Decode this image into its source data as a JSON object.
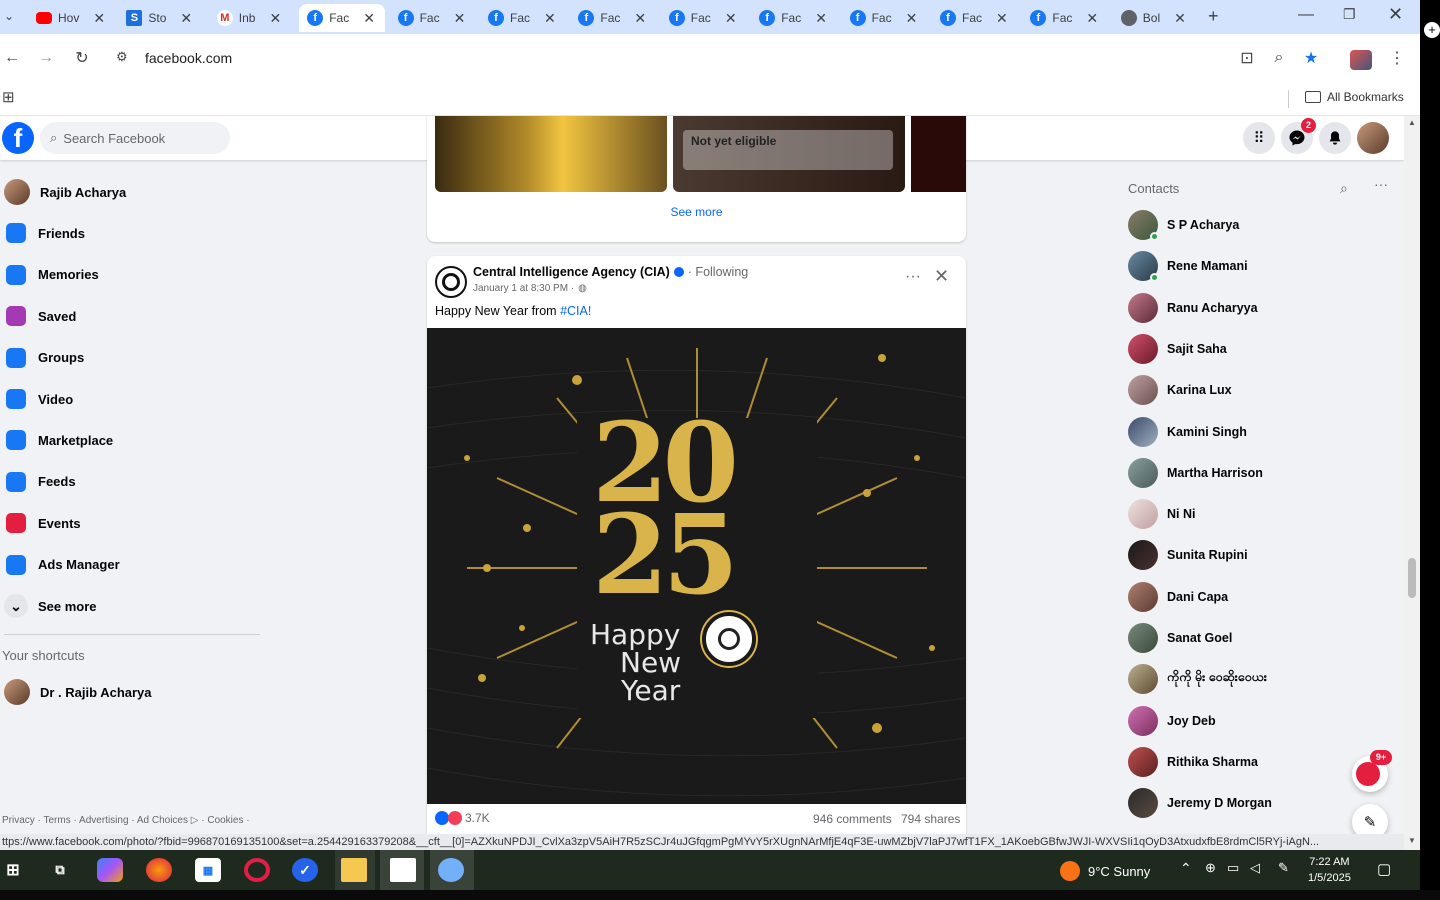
{
  "browser": {
    "tabs": [
      {
        "label": "Hov",
        "icon": "youtube-icon"
      },
      {
        "label": "Sto",
        "icon": "s-icon"
      },
      {
        "label": "Inb",
        "icon": "gmail-icon"
      },
      {
        "label": "Fac",
        "icon": "facebook-icon",
        "active": true
      },
      {
        "label": "Fac",
        "icon": "facebook-icon"
      },
      {
        "label": "Fac",
        "icon": "facebook-icon"
      },
      {
        "label": "Fac",
        "icon": "facebook-icon"
      },
      {
        "label": "Fac",
        "icon": "facebook-icon"
      },
      {
        "label": "Fac",
        "icon": "facebook-icon"
      },
      {
        "label": "Fac",
        "icon": "facebook-icon"
      },
      {
        "label": "Fac",
        "icon": "facebook-icon"
      },
      {
        "label": "Fac",
        "icon": "facebook-icon"
      },
      {
        "label": "Bol",
        "icon": "globe-icon"
      }
    ],
    "url": "facebook.com",
    "all_bookmarks": "All Bookmarks",
    "status_url": "ttps://www.facebook.com/photo/?fbid=996870169135100&set=a.254429163379208&__cft__[0]=AZXkuNPDJI_CvlXa3zpV5AiH7R5zSCJr4uJGfqgmPgMYvY5rXUgnNArMfjE4qF3E-uwMZbjV7laPJ7wfT1FX_1AKoebGBfwJWJI-WXVSIi1qOyD3AtxudxfbE8rdmCl5RYj-iAgN..."
  },
  "facebook": {
    "search_placeholder": "Search Facebook",
    "messenger_badge": "2",
    "sidebar": [
      {
        "label": "Rajib Acharya",
        "icon": "profile-avatar",
        "color": "#8b5a3c"
      },
      {
        "label": "Friends",
        "icon": "friends-icon",
        "color": "#1877f2"
      },
      {
        "label": "Memories",
        "icon": "memories-icon",
        "color": "#1877f2"
      },
      {
        "label": "Saved",
        "icon": "saved-icon",
        "color": "#a33ab2"
      },
      {
        "label": "Groups",
        "icon": "groups-icon",
        "color": "#1877f2"
      },
      {
        "label": "Video",
        "icon": "video-icon",
        "color": "#1877f2"
      },
      {
        "label": "Marketplace",
        "icon": "marketplace-icon",
        "color": "#1877f2"
      },
      {
        "label": "Feeds",
        "icon": "feeds-icon",
        "color": "#1877f2"
      },
      {
        "label": "Events",
        "icon": "events-icon",
        "color": "#e41e3f"
      },
      {
        "label": "Ads Manager",
        "icon": "ads-manager-icon",
        "color": "#1877f2"
      },
      {
        "label": "See more",
        "icon": "chevron-down-icon",
        "color": "#050505"
      }
    ],
    "shortcuts_title": "Your shortcuts",
    "shortcut": "Dr . Rajib Acharya",
    "footer": "Privacy · Terms · Advertising · Ad Choices ▷ · Cookies ·",
    "top_card": {
      "not_eligible": "Not yet eligible",
      "see_more": "See more"
    },
    "post": {
      "author": "Central Intelligence Agency (CIA)",
      "following": "· Following",
      "date": "January 1 at 8:30 PM ·",
      "text_prefix": "Happy New Year from ",
      "hashtag": "#CIA!",
      "image_line1": "Happy",
      "image_line2": "New",
      "image_line3": "Year",
      "image_year_top": "20",
      "image_year_bottom": "25",
      "reactions": "3.7K",
      "comments": "946 comments",
      "shares": "794 shares"
    },
    "contacts_title": "Contacts",
    "contacts": [
      {
        "name": "S P Acharya",
        "online": true
      },
      {
        "name": "Rene Mamani",
        "online": true
      },
      {
        "name": "Ranu Acharyya",
        "online": false
      },
      {
        "name": "Sajit Saha",
        "online": false
      },
      {
        "name": "Karina Lux",
        "online": false
      },
      {
        "name": "Kamini Singh",
        "online": false
      },
      {
        "name": "Martha Harrison",
        "online": false
      },
      {
        "name": "Ni Ni",
        "online": false
      },
      {
        "name": "Sunita Rupini",
        "online": false
      },
      {
        "name": "Dani Capa",
        "online": false
      },
      {
        "name": "Sanat Goel",
        "online": false
      },
      {
        "name": "ကိုကို မိုး ဝေဆိုးဝေယး",
        "online": false
      },
      {
        "name": "Joy Deb",
        "online": false
      },
      {
        "name": "Rithika Sharma",
        "online": false
      },
      {
        "name": "Jeremy D Morgan",
        "online": false
      }
    ],
    "chat_badge": "9+"
  },
  "taskbar": {
    "weather": "9°C  Sunny",
    "time": "7:22 AM",
    "date": "1/5/2025"
  }
}
